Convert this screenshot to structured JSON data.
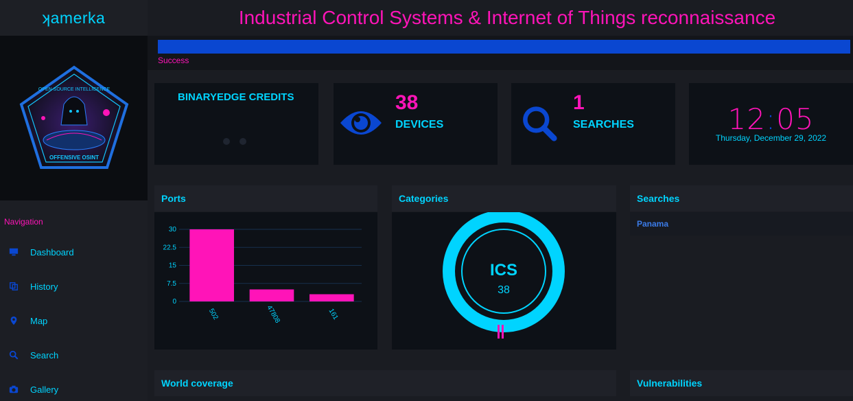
{
  "app": {
    "brand": "ʞamerka"
  },
  "header": {
    "title": "Industrial Control Systems & Internet of Things reconnaissance"
  },
  "status": {
    "label": "Success",
    "progress": 1.0
  },
  "logo": {
    "top_text": "OPEN SOURCE INTELLIGENCE",
    "bottom_text": "OFFENSIVE OSINT"
  },
  "navigation": {
    "title": "Navigation",
    "items": [
      {
        "label": "Dashboard",
        "icon": "monitor-icon"
      },
      {
        "label": "History",
        "icon": "copy-icon"
      },
      {
        "label": "Map",
        "icon": "map-marker-icon"
      },
      {
        "label": "Search",
        "icon": "search-icon"
      },
      {
        "label": "Gallery",
        "icon": "camera-icon"
      }
    ]
  },
  "cards": {
    "credits": {
      "title": "BINARYEDGE CREDITS"
    },
    "devices": {
      "value": "38",
      "label": "DEVICES",
      "icon": "eye-icon"
    },
    "searches": {
      "value": "1",
      "label": "SEARCHES",
      "icon": "search-icon"
    },
    "clock": {
      "hours": "12",
      "minutes": "05",
      "date": "Thursday, December 29, 2022"
    }
  },
  "panels": {
    "ports": {
      "title": "Ports"
    },
    "categories": {
      "title": "Categories",
      "center_label": "ICS",
      "center_value": "38"
    },
    "searches": {
      "title": "Searches",
      "items": [
        "Panama"
      ]
    },
    "world": {
      "title": "World coverage"
    },
    "vulns": {
      "title": "Vulnerabilities"
    }
  },
  "colors": {
    "accent": "#00d4ff",
    "brand": "#ff14b8",
    "blue": "#0a47d1"
  },
  "chart_data": [
    {
      "type": "bar",
      "categories": [
        "502",
        "47808",
        "161"
      ],
      "values": [
        30,
        5,
        3
      ],
      "title": "Ports",
      "xlabel": "",
      "ylabel": "",
      "ylim": [
        0,
        30
      ],
      "yticks": [
        "30",
        "22.5",
        "15",
        "7.5",
        "0"
      ],
      "grid": true,
      "color": "#ff14b8"
    },
    {
      "type": "pie",
      "categories": [
        "ICS"
      ],
      "values": [
        38
      ],
      "title": "Categories",
      "color": "#00d4ff"
    }
  ]
}
